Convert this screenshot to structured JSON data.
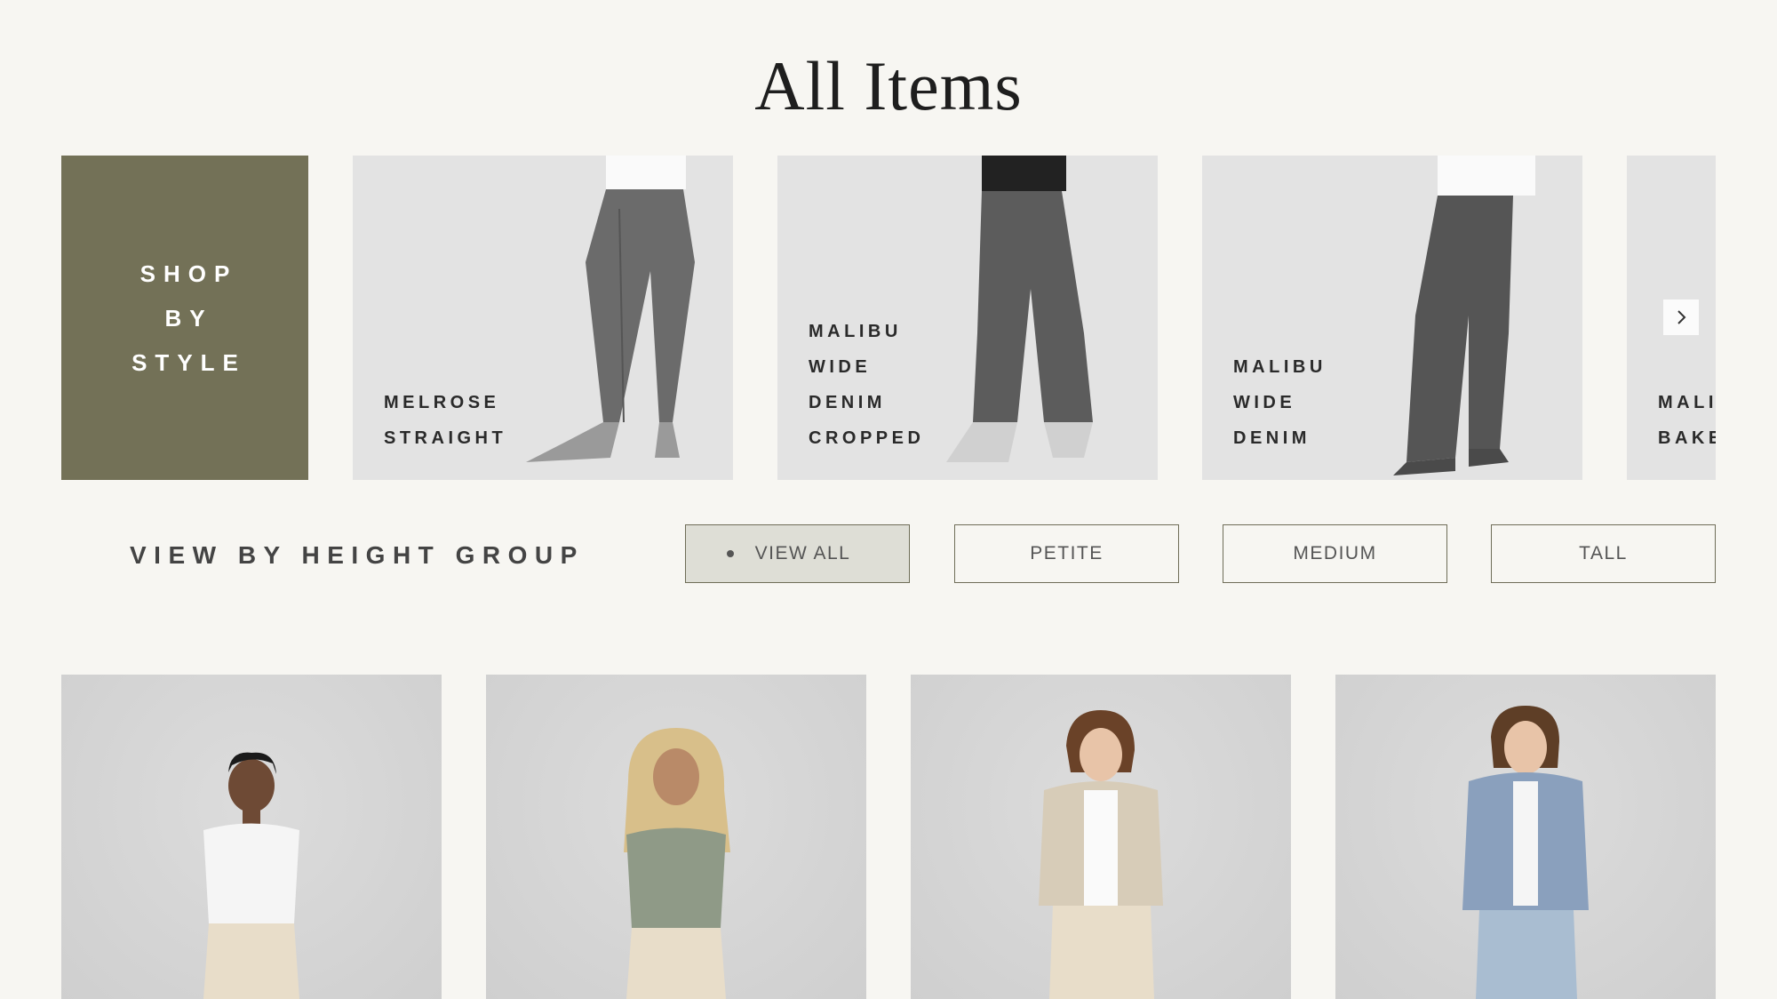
{
  "page": {
    "title": "All Items"
  },
  "styles": {
    "shop_by_style": [
      "SHOP",
      "BY",
      "STYLE"
    ],
    "cards": [
      {
        "lines": [
          "MELROSE",
          "STRAIGHT"
        ]
      },
      {
        "lines": [
          "MALIBU",
          "WIDE",
          "DENIM",
          "CROPPED"
        ]
      },
      {
        "lines": [
          "MALIBU",
          "WIDE",
          "DENIM"
        ]
      },
      {
        "lines": [
          "MALI",
          "BAKE"
        ]
      }
    ],
    "next_icon": "chevron-right-icon"
  },
  "height_group": {
    "label": "VIEW BY HEIGHT GROUP",
    "options": [
      {
        "label": "VIEW ALL",
        "active": true
      },
      {
        "label": "PETITE",
        "active": false
      },
      {
        "label": "MEDIUM",
        "active": false
      },
      {
        "label": "TALL",
        "active": false
      }
    ]
  },
  "colors": {
    "accent": "#737157",
    "background": "#f7f6f2",
    "card": "#e3e3e3",
    "active_filter": "#deded6"
  }
}
